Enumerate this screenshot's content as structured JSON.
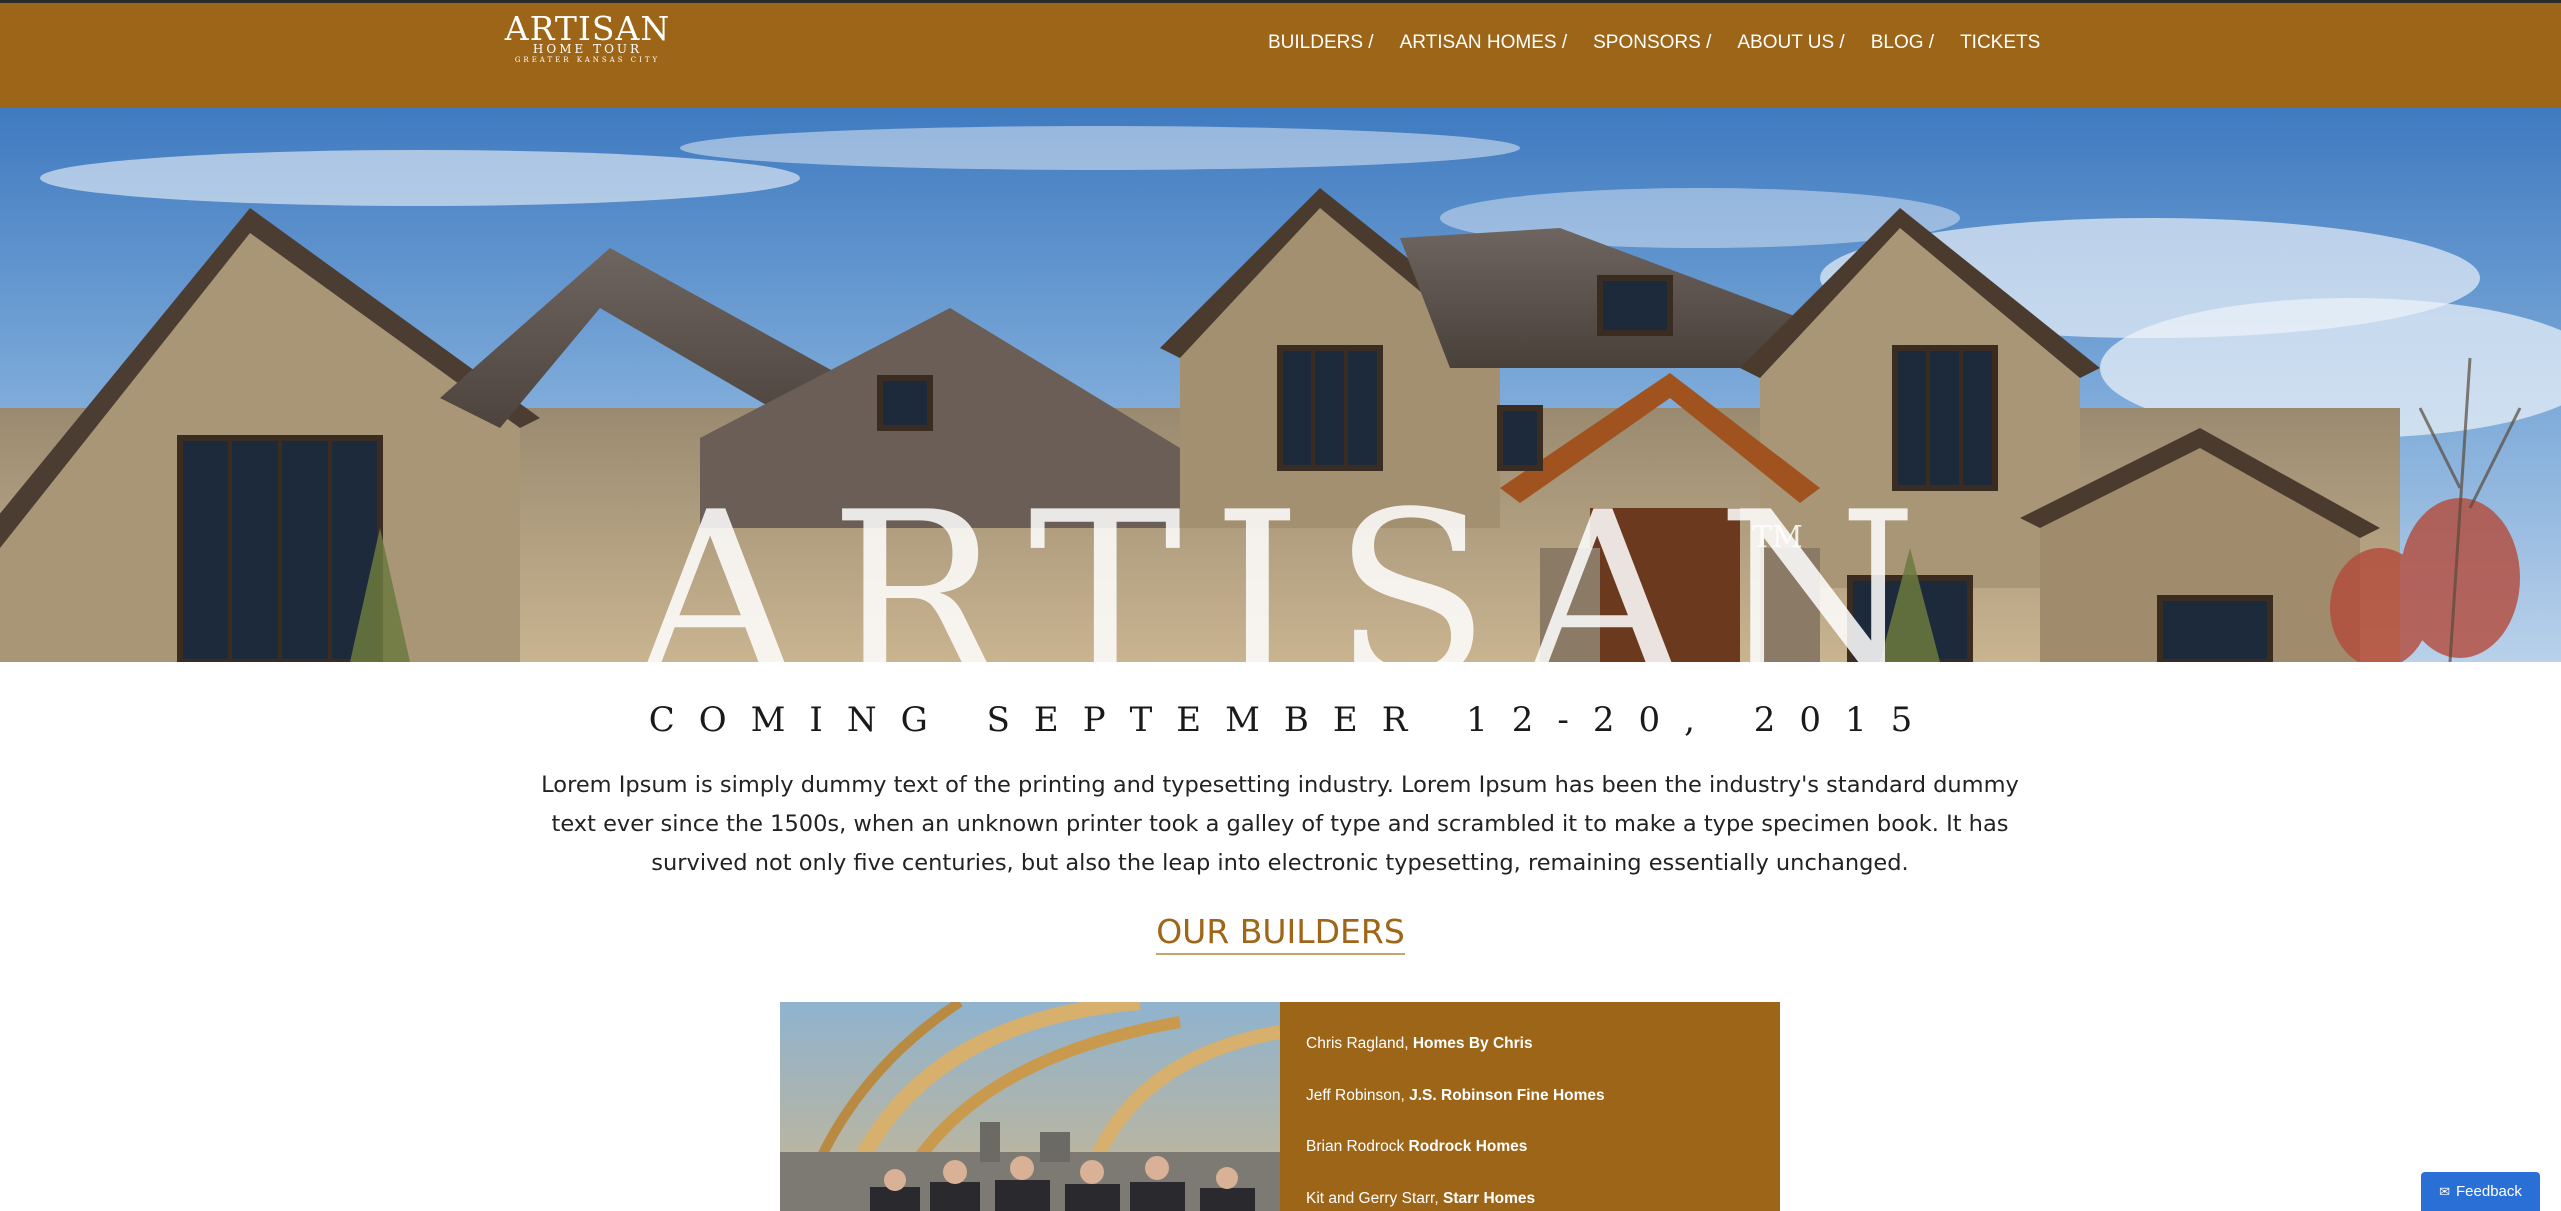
{
  "header": {
    "logo_main": "ARTISAN",
    "logo_sub": "HOME TOUR",
    "logo_sub2": "GREATER KANSAS CITY",
    "nav": [
      {
        "label": "BUILDERS /"
      },
      {
        "label": "ARTISAN HOMES /"
      },
      {
        "label": "SPONSORS /"
      },
      {
        "label": "ABOUT US /"
      },
      {
        "label": "BLOG /"
      },
      {
        "label": "TICKETS"
      }
    ]
  },
  "hero": {
    "title": "ARTISAN",
    "trademark": "TM"
  },
  "main": {
    "coming": "COMING SEPTEMBER 12-20, 2015",
    "intro": "Lorem Ipsum is simply dummy text of the printing and typesetting industry. Lorem Ipsum has been the industry's standard dummy text ever since the 1500s, when an unknown printer took a galley of type and scrambled it to make a type specimen book. It has survived not only five centuries, but also the leap into electronic typesetting, remaining essentially unchanged.",
    "builders_heading": "OUR BUILDERS",
    "builders": [
      {
        "person": "Chris Ragland,",
        "company": "Homes By Chris"
      },
      {
        "person": "Jeff Robinson,",
        "company": "J.S. Robinson Fine Homes"
      },
      {
        "person": "Brian Rodrock",
        "company": "Rodrock Homes"
      },
      {
        "person": "Kit and Gerry Starr,",
        "company": "Starr Homes"
      }
    ]
  },
  "feedback": {
    "label": "Feedback",
    "icon": "chat-bubble-icon"
  },
  "colors": {
    "brand_brown": "#9d6518",
    "heading_brown": "#a06617",
    "feedback_blue": "#2a6fd6"
  }
}
